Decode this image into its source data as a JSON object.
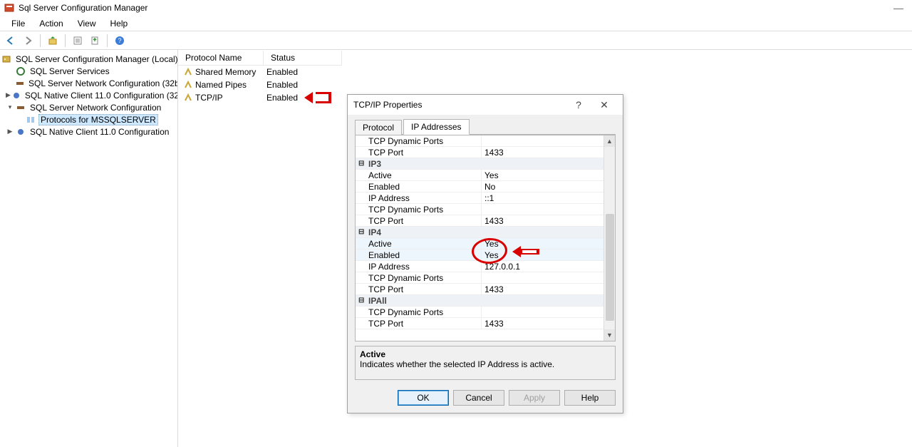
{
  "window": {
    "title": "Sql Server Configuration Manager"
  },
  "menus": [
    "File",
    "Action",
    "View",
    "Help"
  ],
  "tree": {
    "root": "SQL Server Configuration Manager (Local)",
    "items": [
      "SQL Server Services",
      "SQL Server Network Configuration (32bit",
      "SQL Native Client 11.0 Configuration (32",
      "SQL Server Network Configuration",
      "Protocols for MSSQLSERVER",
      "SQL Native Client 11.0 Configuration"
    ]
  },
  "list": {
    "headers": {
      "name": "Protocol Name",
      "status": "Status"
    },
    "rows": [
      {
        "name": "Shared Memory",
        "status": "Enabled"
      },
      {
        "name": "Named Pipes",
        "status": "Enabled"
      },
      {
        "name": "TCP/IP",
        "status": "Enabled"
      }
    ]
  },
  "dialog": {
    "title": "TCP/IP Properties",
    "tabs": {
      "protocol": "Protocol",
      "ip": "IP Addresses"
    },
    "rows": [
      {
        "type": "row",
        "label": "TCP Dynamic Ports",
        "value": ""
      },
      {
        "type": "row",
        "label": "TCP Port",
        "value": "1433"
      },
      {
        "type": "group",
        "label": "IP3"
      },
      {
        "type": "row",
        "label": "Active",
        "value": "Yes"
      },
      {
        "type": "row",
        "label": "Enabled",
        "value": "No"
      },
      {
        "type": "row",
        "label": "IP Address",
        "value": "::1"
      },
      {
        "type": "row",
        "label": "TCP Dynamic Ports",
        "value": ""
      },
      {
        "type": "row",
        "label": "TCP Port",
        "value": "1433"
      },
      {
        "type": "group",
        "label": "IP4"
      },
      {
        "type": "row",
        "label": "Active",
        "value": "Yes",
        "highlight": true
      },
      {
        "type": "row",
        "label": "Enabled",
        "value": "Yes",
        "highlight": true
      },
      {
        "type": "row",
        "label": "IP Address",
        "value": "127.0.0.1"
      },
      {
        "type": "row",
        "label": "TCP Dynamic Ports",
        "value": ""
      },
      {
        "type": "row",
        "label": "TCP Port",
        "value": "1433"
      },
      {
        "type": "group",
        "label": "IPAll"
      },
      {
        "type": "row",
        "label": "TCP Dynamic Ports",
        "value": ""
      },
      {
        "type": "row",
        "label": "TCP Port",
        "value": "1433"
      }
    ],
    "desc": {
      "title": "Active",
      "text": "Indicates whether the selected IP Address is active."
    },
    "buttons": {
      "ok": "OK",
      "cancel": "Cancel",
      "apply": "Apply",
      "help": "Help"
    }
  }
}
